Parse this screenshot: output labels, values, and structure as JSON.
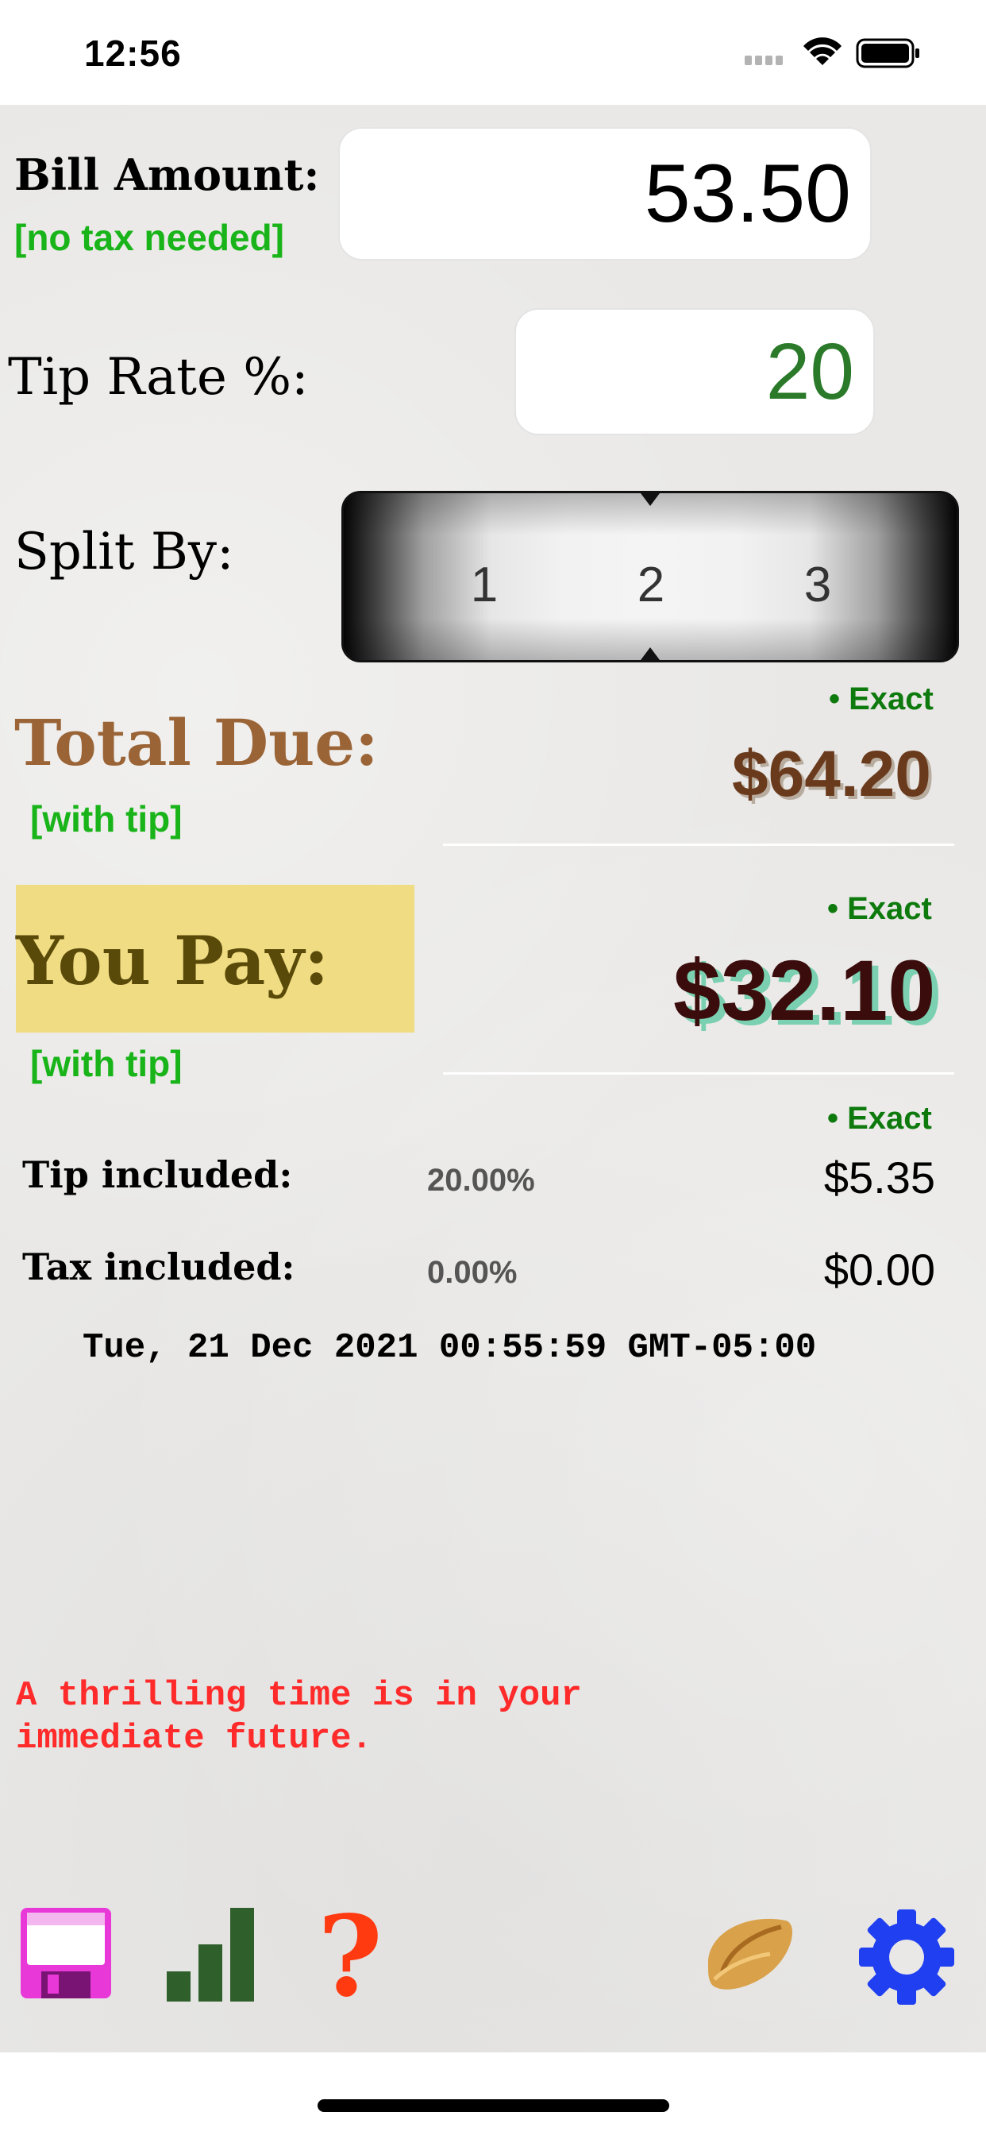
{
  "status_bar": {
    "time": "12:56"
  },
  "bill": {
    "label": "Bill Amount:",
    "note": "[no tax needed]",
    "value": "53.50"
  },
  "tip_rate": {
    "label": "Tip Rate %:",
    "value": "20"
  },
  "split": {
    "label": "Split By:",
    "options": [
      "1",
      "2",
      "3"
    ],
    "selected": "2"
  },
  "total_due": {
    "label": "Total Due:",
    "note": "[with tip]",
    "exact_label": "• Exact",
    "amount": "$64.20"
  },
  "you_pay": {
    "label": "You Pay:",
    "note": "[with tip]",
    "exact_label": "• Exact",
    "amount": "$32.10"
  },
  "breakdown": {
    "exact_label": "• Exact",
    "tip": {
      "label": "Tip included:",
      "percent": "20.00%",
      "amount": "$5.35"
    },
    "tax": {
      "label": "Tax included:",
      "percent": "0.00%",
      "amount": "$0.00"
    }
  },
  "timestamp": "Tue, 21 Dec 2021 00:55:59 GMT-05:00",
  "fortune": {
    "line1": "A thrilling time is in your",
    "line2": "immediate future."
  },
  "toolbar": {
    "icons": [
      "floppy-disk-icon",
      "bar-chart-icon",
      "question-mark-icon",
      "fortune-cookie-icon",
      "gear-icon"
    ]
  },
  "colors": {
    "accent_green": "#19b419",
    "exact_green": "#0e7a0e",
    "total_due_brown": "#9a6436",
    "you_pay_highlight": "#f0dc82",
    "fortune_red": "#ff2a2a",
    "floppy_magenta": "#e838d8",
    "chart_green": "#2f5f2a",
    "help_red": "#ff3a10",
    "gear_blue": "#1f3ff0"
  }
}
